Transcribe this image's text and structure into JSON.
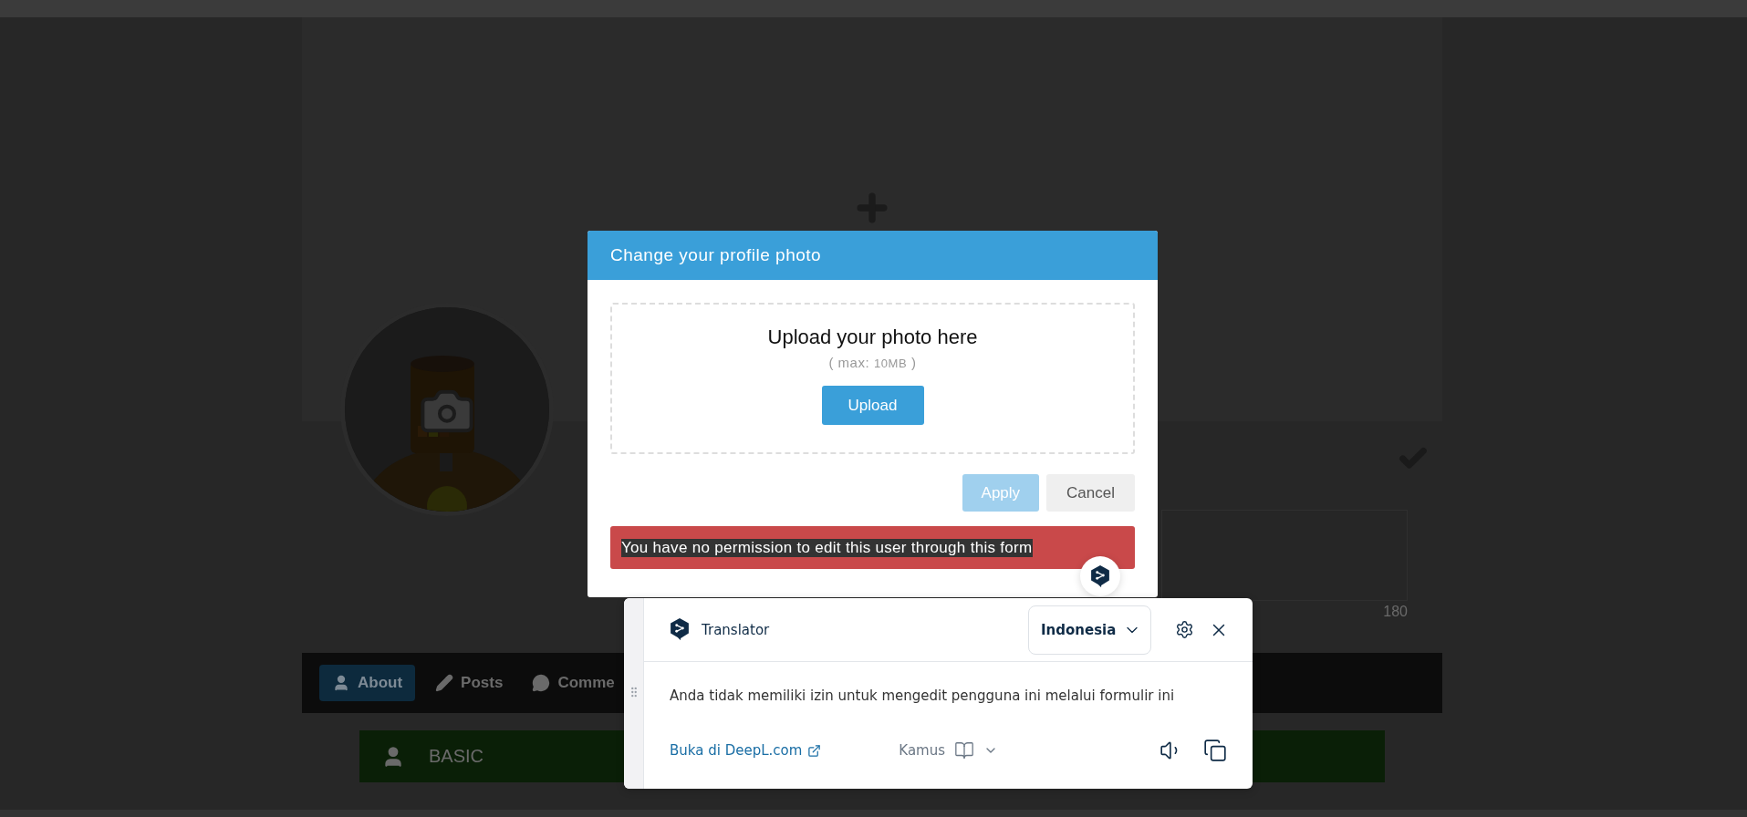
{
  "profile": {
    "tabs": [
      {
        "label": "About",
        "selected": true
      },
      {
        "label": "Posts",
        "selected": false
      },
      {
        "label": "Comme",
        "selected": false
      }
    ],
    "section": {
      "title": "BASIC"
    },
    "bio_counter": "180"
  },
  "modal": {
    "title": "Change your profile photo",
    "dropzone": {
      "heading": "Upload your photo here",
      "limit_open": "( max:",
      "limit_value": "10MB",
      "limit_close": ")",
      "button": "Upload"
    },
    "buttons": [
      {
        "label": "Apply",
        "kind": "primary",
        "disabled": true
      },
      {
        "label": "Cancel",
        "kind": "secondary",
        "disabled": false
      }
    ],
    "alert": {
      "text": "You have no permission to edit this user through this form",
      "highlighted": true
    }
  },
  "translator": {
    "title": "Translator",
    "language": "Indonesia",
    "translation": "Anda tidak memiliki izin untuk mengedit pengguna ini melalui formulir ini",
    "open_link": "Buka di DeepL.com",
    "dictionary": "Kamus"
  }
}
